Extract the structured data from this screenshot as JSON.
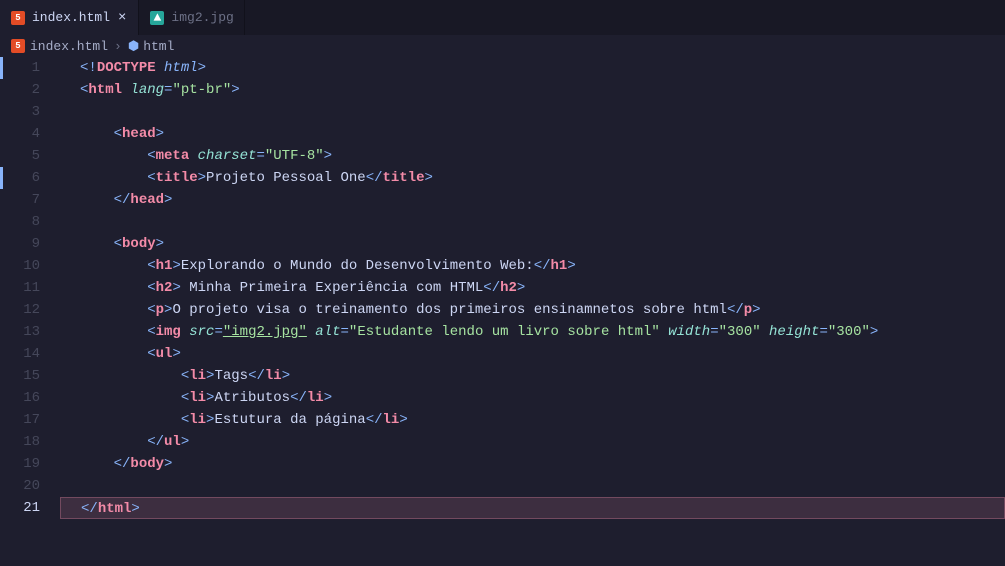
{
  "tabs": [
    {
      "label": "index.html",
      "icon": "html5",
      "active": true,
      "closeable": true
    },
    {
      "label": "img2.jpg",
      "icon": "image",
      "active": false,
      "closeable": false
    }
  ],
  "breadcrumb": [
    {
      "icon": "html5",
      "label": "index.html"
    },
    {
      "icon": "cube",
      "label": "html"
    }
  ],
  "gutter_markers": [
    1,
    6
  ],
  "current_line": 21,
  "code": {
    "lines": [
      {
        "n": 1,
        "tokens": [
          {
            "t": "<!",
            "c": "c-punct"
          },
          {
            "t": "DOCTYPE",
            "c": "c-doctype"
          },
          {
            "t": " ",
            "c": "c-text"
          },
          {
            "t": "html",
            "c": "c-html-kw"
          },
          {
            "t": ">",
            "c": "c-punct"
          }
        ],
        "indent": 0
      },
      {
        "n": 2,
        "tokens": [
          {
            "t": "<",
            "c": "c-punct"
          },
          {
            "t": "html",
            "c": "c-tag"
          },
          {
            "t": " ",
            "c": "c-text"
          },
          {
            "t": "lang",
            "c": "c-attr"
          },
          {
            "t": "=",
            "c": "c-punct"
          },
          {
            "t": "\"pt-br\"",
            "c": "c-string"
          },
          {
            "t": ">",
            "c": "c-punct"
          }
        ],
        "indent": 0
      },
      {
        "n": 3,
        "tokens": [],
        "indent": 0
      },
      {
        "n": 4,
        "tokens": [
          {
            "t": "<",
            "c": "c-punct"
          },
          {
            "t": "head",
            "c": "c-tag"
          },
          {
            "t": ">",
            "c": "c-punct"
          }
        ],
        "indent": 1
      },
      {
        "n": 5,
        "tokens": [
          {
            "t": "<",
            "c": "c-punct"
          },
          {
            "t": "meta",
            "c": "c-tag"
          },
          {
            "t": " ",
            "c": "c-text"
          },
          {
            "t": "charset",
            "c": "c-attr"
          },
          {
            "t": "=",
            "c": "c-punct"
          },
          {
            "t": "\"UTF-8\"",
            "c": "c-string"
          },
          {
            "t": ">",
            "c": "c-punct"
          }
        ],
        "indent": 2
      },
      {
        "n": 6,
        "tokens": [
          {
            "t": "<",
            "c": "c-punct"
          },
          {
            "t": "title",
            "c": "c-tag"
          },
          {
            "t": ">",
            "c": "c-punct"
          },
          {
            "t": "Projeto Pessoal One",
            "c": "c-text"
          },
          {
            "t": "</",
            "c": "c-punct"
          },
          {
            "t": "title",
            "c": "c-tag"
          },
          {
            "t": ">",
            "c": "c-punct"
          }
        ],
        "indent": 2
      },
      {
        "n": 7,
        "tokens": [
          {
            "t": "</",
            "c": "c-punct"
          },
          {
            "t": "head",
            "c": "c-tag"
          },
          {
            "t": ">",
            "c": "c-punct"
          }
        ],
        "indent": 1
      },
      {
        "n": 8,
        "tokens": [],
        "indent": 0
      },
      {
        "n": 9,
        "tokens": [
          {
            "t": "<",
            "c": "c-punct"
          },
          {
            "t": "body",
            "c": "c-tag"
          },
          {
            "t": ">",
            "c": "c-punct"
          }
        ],
        "indent": 1
      },
      {
        "n": 10,
        "tokens": [
          {
            "t": "<",
            "c": "c-punct"
          },
          {
            "t": "h1",
            "c": "c-tag"
          },
          {
            "t": ">",
            "c": "c-punct"
          },
          {
            "t": "Explorando o Mundo do Desenvolvimento Web:",
            "c": "c-text"
          },
          {
            "t": "</",
            "c": "c-punct"
          },
          {
            "t": "h1",
            "c": "c-tag"
          },
          {
            "t": ">",
            "c": "c-punct"
          }
        ],
        "indent": 2
      },
      {
        "n": 11,
        "tokens": [
          {
            "t": "<",
            "c": "c-punct"
          },
          {
            "t": "h2",
            "c": "c-tag"
          },
          {
            "t": ">",
            "c": "c-punct"
          },
          {
            "t": " Minha Primeira Experiência com HTML",
            "c": "c-text"
          },
          {
            "t": "</",
            "c": "c-punct"
          },
          {
            "t": "h2",
            "c": "c-tag"
          },
          {
            "t": ">",
            "c": "c-punct"
          }
        ],
        "indent": 2
      },
      {
        "n": 12,
        "tokens": [
          {
            "t": "<",
            "c": "c-punct"
          },
          {
            "t": "p",
            "c": "c-tag"
          },
          {
            "t": ">",
            "c": "c-punct"
          },
          {
            "t": "O projeto visa o treinamento dos primeiros ensinamnetos sobre html",
            "c": "c-text"
          },
          {
            "t": "</",
            "c": "c-punct"
          },
          {
            "t": "p",
            "c": "c-tag"
          },
          {
            "t": ">",
            "c": "c-punct"
          }
        ],
        "indent": 2
      },
      {
        "n": 13,
        "tokens": [
          {
            "t": "<",
            "c": "c-punct"
          },
          {
            "t": "img",
            "c": "c-tag"
          },
          {
            "t": " ",
            "c": "c-text"
          },
          {
            "t": "src",
            "c": "c-attr"
          },
          {
            "t": "=",
            "c": "c-punct"
          },
          {
            "t": "\"img2.jpg\"",
            "c": "c-string underline-squiggle"
          },
          {
            "t": " ",
            "c": "c-text"
          },
          {
            "t": "alt",
            "c": "c-attr"
          },
          {
            "t": "=",
            "c": "c-punct"
          },
          {
            "t": "\"Estudante lendo um livro sobre html\"",
            "c": "c-string"
          },
          {
            "t": " ",
            "c": "c-text"
          },
          {
            "t": "width",
            "c": "c-attr"
          },
          {
            "t": "=",
            "c": "c-punct"
          },
          {
            "t": "\"300\"",
            "c": "c-string"
          },
          {
            "t": " ",
            "c": "c-text"
          },
          {
            "t": "height",
            "c": "c-attr"
          },
          {
            "t": "=",
            "c": "c-punct"
          },
          {
            "t": "\"300\"",
            "c": "c-string"
          },
          {
            "t": ">",
            "c": "c-punct"
          }
        ],
        "indent": 2
      },
      {
        "n": 14,
        "tokens": [
          {
            "t": "<",
            "c": "c-punct"
          },
          {
            "t": "ul",
            "c": "c-tag"
          },
          {
            "t": ">",
            "c": "c-punct"
          }
        ],
        "indent": 2
      },
      {
        "n": 15,
        "tokens": [
          {
            "t": "<",
            "c": "c-punct"
          },
          {
            "t": "li",
            "c": "c-tag"
          },
          {
            "t": ">",
            "c": "c-punct"
          },
          {
            "t": "Tags",
            "c": "c-text"
          },
          {
            "t": "</",
            "c": "c-punct"
          },
          {
            "t": "li",
            "c": "c-tag"
          },
          {
            "t": ">",
            "c": "c-punct"
          }
        ],
        "indent": 3
      },
      {
        "n": 16,
        "tokens": [
          {
            "t": "<",
            "c": "c-punct"
          },
          {
            "t": "li",
            "c": "c-tag"
          },
          {
            "t": ">",
            "c": "c-punct"
          },
          {
            "t": "Atributos",
            "c": "c-text"
          },
          {
            "t": "</",
            "c": "c-punct"
          },
          {
            "t": "li",
            "c": "c-tag"
          },
          {
            "t": ">",
            "c": "c-punct"
          }
        ],
        "indent": 3
      },
      {
        "n": 17,
        "tokens": [
          {
            "t": "<",
            "c": "c-punct"
          },
          {
            "t": "li",
            "c": "c-tag"
          },
          {
            "t": ">",
            "c": "c-punct"
          },
          {
            "t": "Estutura da página",
            "c": "c-text"
          },
          {
            "t": "</",
            "c": "c-punct"
          },
          {
            "t": "li",
            "c": "c-tag"
          },
          {
            "t": ">",
            "c": "c-punct"
          }
        ],
        "indent": 3
      },
      {
        "n": 18,
        "tokens": [
          {
            "t": "</",
            "c": "c-punct"
          },
          {
            "t": "ul",
            "c": "c-tag"
          },
          {
            "t": ">",
            "c": "c-punct"
          }
        ],
        "indent": 2
      },
      {
        "n": 19,
        "tokens": [
          {
            "t": "</",
            "c": "c-punct"
          },
          {
            "t": "body",
            "c": "c-tag"
          },
          {
            "t": ">",
            "c": "c-punct"
          }
        ],
        "indent": 1
      },
      {
        "n": 20,
        "tokens": [],
        "indent": 0
      },
      {
        "n": 21,
        "tokens": [
          {
            "t": "</",
            "c": "c-punct"
          },
          {
            "t": "html",
            "c": "c-tag"
          },
          {
            "t": ">",
            "c": "c-punct"
          }
        ],
        "indent": 0,
        "highlight": true
      }
    ]
  }
}
